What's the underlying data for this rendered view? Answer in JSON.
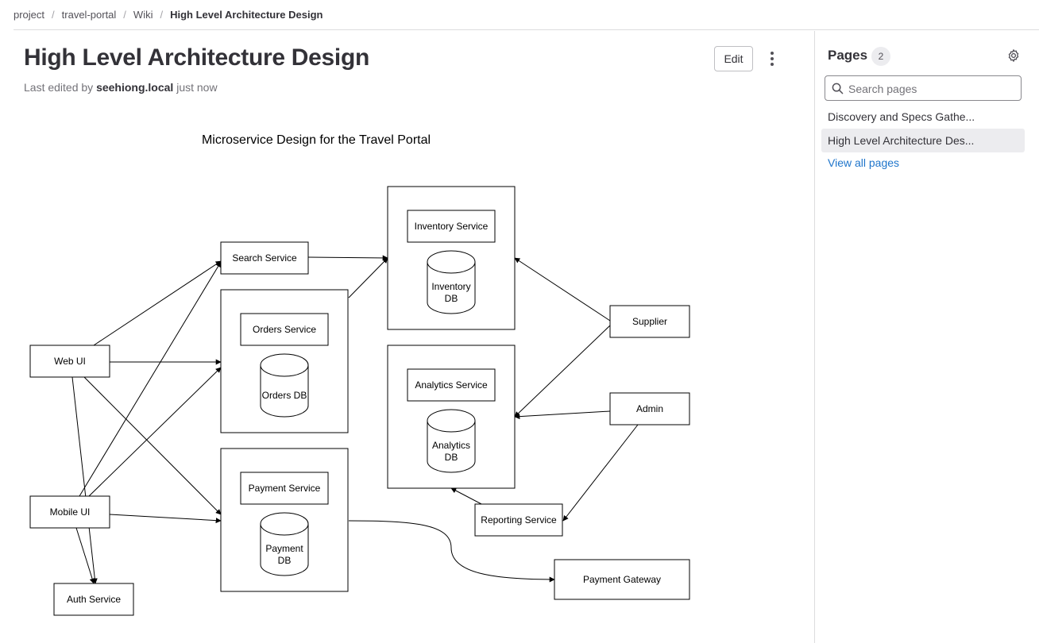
{
  "breadcrumb": {
    "items": [
      "project",
      "travel-portal",
      "Wiki",
      "High Level Architecture Design"
    ],
    "separator": "/"
  },
  "page": {
    "title": "High Level Architecture Design",
    "edited_prefix": "Last edited by",
    "edited_user": "seehiong.local",
    "edited_suffix": "just now",
    "edit_label": "Edit",
    "more_icon": "kebab-vertical-icon"
  },
  "diagram": {
    "title": "Microservice Design for the Travel Portal",
    "services": {
      "search": "Search Service",
      "orders": "Orders Service",
      "payment": "Payment Service",
      "inventory": "Inventory Service",
      "analytics": "Analytics Service",
      "web_ui": "Web UI",
      "mobile_ui": "Mobile UI",
      "auth": "Auth Service",
      "supplier": "Supplier",
      "admin": "Admin",
      "reporting": "Reporting Service",
      "gateway": "Payment Gateway"
    },
    "databases": {
      "orders_db": [
        "Orders DB"
      ],
      "payment_db": [
        "Payment",
        "DB"
      ],
      "inventory_db": [
        "Inventory",
        "DB"
      ],
      "analytics_db": [
        "Analytics",
        "DB"
      ]
    }
  },
  "sidebar": {
    "heading": "Pages",
    "count": "2",
    "settings_icon": "gear-icon",
    "search_placeholder": "Search pages",
    "search_icon": "search-icon",
    "pages": [
      {
        "label": "Discovery and Specs Gathe...",
        "active": false
      },
      {
        "label": "High Level Architecture Des...",
        "active": true
      }
    ],
    "view_all": "View all pages"
  }
}
